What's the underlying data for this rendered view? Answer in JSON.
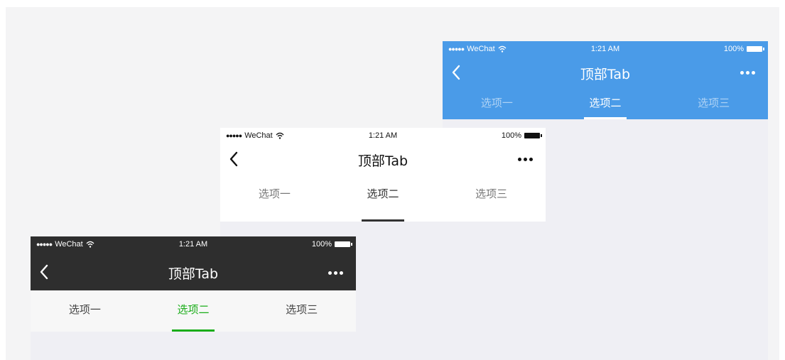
{
  "screens": [
    {
      "theme": "blue",
      "status_bar": {
        "carrier": "WeChat",
        "signal": "●●●●●",
        "time": "1:21 AM",
        "battery": "100%"
      },
      "nav": {
        "title": "顶部Tab",
        "back_icon": "chevron-left-icon",
        "more_icon": "more-dots-icon"
      },
      "tabs": [
        {
          "label": "选项一",
          "active": false
        },
        {
          "label": "选项二",
          "active": true
        },
        {
          "label": "选项三",
          "active": false
        }
      ],
      "colors": {
        "bar": "#4a9be8",
        "active_tab": "#ffffff"
      }
    },
    {
      "theme": "white",
      "status_bar": {
        "carrier": "WeChat",
        "signal": "●●●●●",
        "time": "1:21 AM",
        "battery": "100%"
      },
      "nav": {
        "title": "顶部Tab",
        "back_icon": "chevron-left-icon",
        "more_icon": "more-dots-icon"
      },
      "tabs": [
        {
          "label": "选项一",
          "active": false
        },
        {
          "label": "选项二",
          "active": true
        },
        {
          "label": "选项三",
          "active": false
        }
      ],
      "colors": {
        "bar": "#ffffff",
        "active_tab": "#333333"
      }
    },
    {
      "theme": "dark",
      "status_bar": {
        "carrier": "WeChat",
        "signal": "●●●●●",
        "time": "1:21 AM",
        "battery": "100%"
      },
      "nav": {
        "title": "顶部Tab",
        "back_icon": "chevron-left-icon",
        "more_icon": "more-dots-icon"
      },
      "tabs": [
        {
          "label": "选项一",
          "active": false
        },
        {
          "label": "选项二",
          "active": true
        },
        {
          "label": "选项三",
          "active": false
        }
      ],
      "colors": {
        "bar": "#2e2e2e",
        "active_tab": "#1aad19"
      }
    }
  ]
}
